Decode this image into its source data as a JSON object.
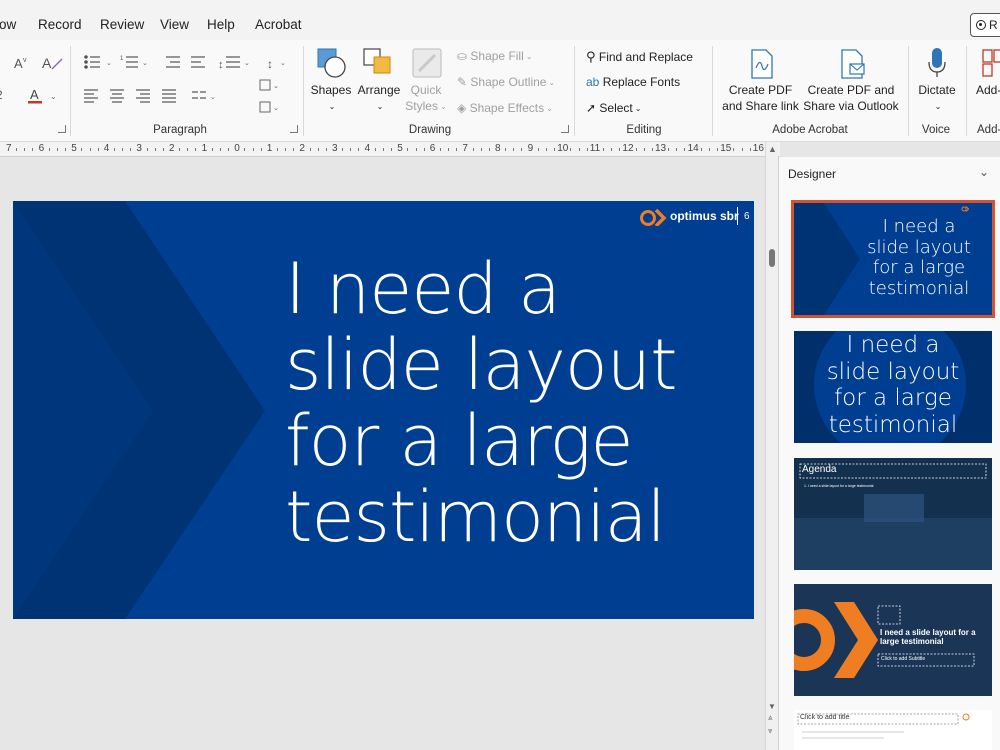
{
  "menu": {
    "items": [
      "ow",
      "Record",
      "Review",
      "View",
      "Help",
      "Acrobat"
    ],
    "record_button": "R"
  },
  "ribbon": {
    "paragraph": {
      "label": "Paragraph"
    },
    "drawing": {
      "label": "Drawing",
      "shapes": "Shapes",
      "arrange": "Arrange",
      "quick_styles": "Quick Styles",
      "shape_fill": "Shape Fill",
      "shape_outline": "Shape Outline",
      "shape_effects": "Shape Effects"
    },
    "editing": {
      "label": "Editing",
      "find_replace": "Find and Replace",
      "replace_fonts": "Replace Fonts",
      "select": "Select"
    },
    "acrobat": {
      "label": "Adobe Acrobat",
      "create_pdf_share": "Create PDF and Share link",
      "create_pdf_outlook": "Create PDF and Share via Outlook"
    },
    "voice": {
      "label": "Voice",
      "dictate": "Dictate"
    },
    "addins": {
      "label": "Add-",
      "button": "Add-"
    }
  },
  "ruler": {
    "numbers": [
      "7",
      "6",
      "5",
      "4",
      "3",
      "2",
      "1",
      "0",
      "1",
      "2",
      "3",
      "4",
      "5",
      "6",
      "7",
      "8",
      "9",
      "10",
      "11",
      "12",
      "13",
      "14",
      "15",
      "16"
    ]
  },
  "slide": {
    "lines": [
      "I need a",
      "slide layout",
      "for a large",
      "testimonial"
    ],
    "logo_text": "optimus sbr",
    "slide_number": "6"
  },
  "designer": {
    "title": "Designer",
    "design1_lines": [
      "I need a",
      "slide layout",
      "for a large",
      "testimonial"
    ],
    "design2_lines": [
      "I need a",
      "slide layout",
      "for a large",
      "testimonial"
    ],
    "design3_title": "Agenda",
    "design3_item": "1.  I need a slide layout for a large testimonial",
    "design4_title": "I need a slide layout for a large testimonial",
    "design4_subtitle": "Click to add Subtitle",
    "design5_title": "Click to add title"
  },
  "colors": {
    "slide_blue": "#003e92",
    "chevron_blue": "#003374",
    "accent_orange": "#ef7d22",
    "selection_red": "#d35230"
  }
}
